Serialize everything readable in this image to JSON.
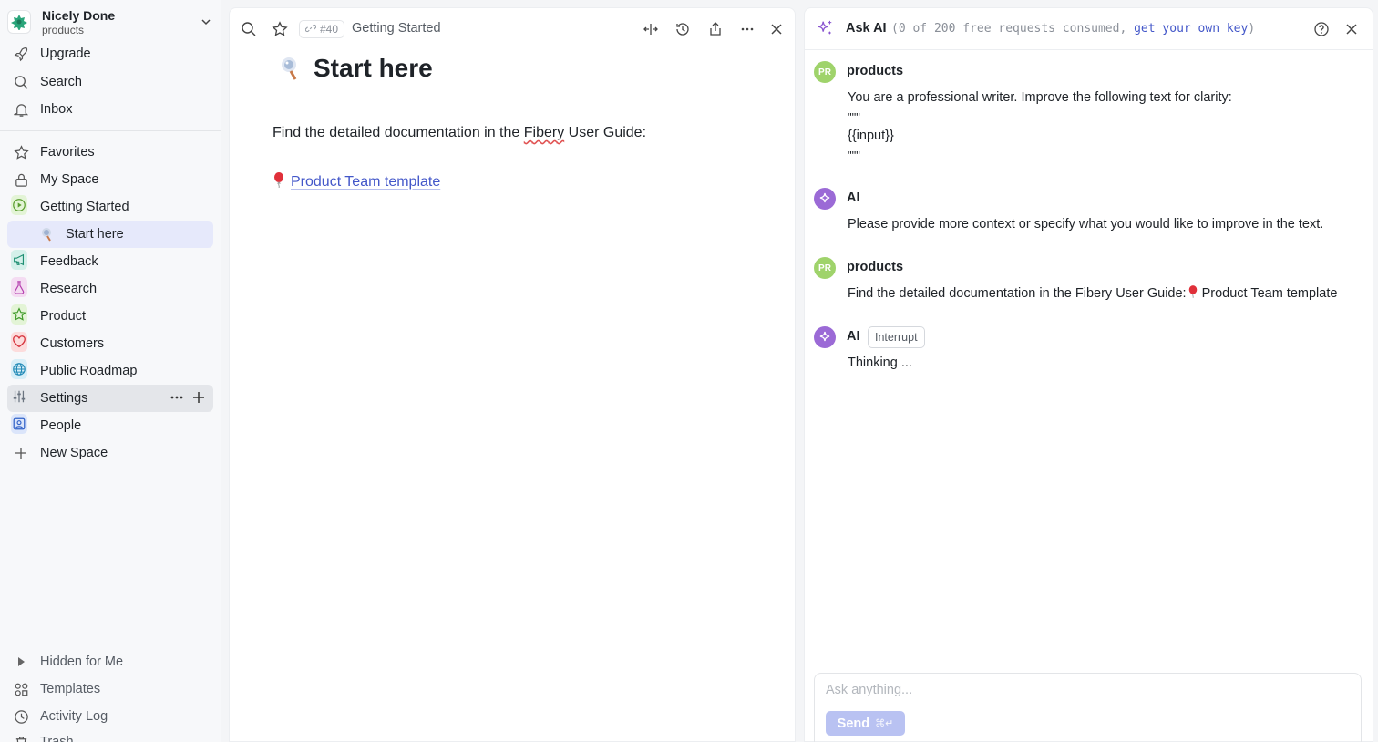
{
  "workspace": {
    "name": "Nicely Done",
    "subtitle": "products"
  },
  "sidebar": {
    "top": [
      {
        "label": "Upgrade",
        "icon": "rocket-icon"
      },
      {
        "label": "Search",
        "icon": "search-icon"
      },
      {
        "label": "Inbox",
        "icon": "bell-icon"
      }
    ],
    "spaces": [
      {
        "label": "Favorites",
        "icon": "star-icon"
      },
      {
        "label": "My Space",
        "icon": "lock-icon"
      },
      {
        "label": "Getting Started",
        "icon": "play-icon"
      },
      {
        "label": "Start here",
        "icon": "start-here-emoji-icon"
      },
      {
        "label": "Feedback",
        "icon": "megaphone-icon"
      },
      {
        "label": "Research",
        "icon": "flask-icon"
      },
      {
        "label": "Product",
        "icon": "star-icon"
      },
      {
        "label": "Customers",
        "icon": "heart-icon"
      },
      {
        "label": "Public Roadmap",
        "icon": "globe-icon"
      },
      {
        "label": "Settings",
        "icon": "sliders-icon"
      },
      {
        "label": "People",
        "icon": "person-card-icon"
      },
      {
        "label": "New Space",
        "icon": "plus-icon"
      }
    ],
    "bottom": [
      {
        "label": "Hidden for Me",
        "icon": "triangle-right-icon"
      },
      {
        "label": "Templates",
        "icon": "templates-icon"
      },
      {
        "label": "Activity Log",
        "icon": "clock-icon"
      },
      {
        "label": "Trash",
        "icon": "trash-icon"
      }
    ]
  },
  "doc": {
    "id_tag": "#40",
    "breadcrumb": "Getting Started",
    "title": "Start here",
    "para_before": "Find the detailed documentation in the ",
    "para_spell": "Fibery",
    "para_after": " User Guide:",
    "link_text": "Product Team template"
  },
  "ai": {
    "title": "Ask AI",
    "quota_prefix": "(0 of 200 free requests consumed, ",
    "quota_link": "get your own key",
    "quota_suffix": ")",
    "messages": [
      {
        "author": "products",
        "avatar": "PR",
        "lines": [
          "You are a professional writer. Improve the following text for clarity:",
          "\"\"\"",
          "{{input}}",
          "\"\"\""
        ]
      },
      {
        "author": "AI",
        "lines": [
          "Please provide more context or specify what you would like to improve in the text."
        ]
      },
      {
        "author": "products",
        "avatar": "PR",
        "lines": [
          "Find the detailed documentation in the Fibery User Guide:",
          "Product Team template"
        ]
      },
      {
        "author": "AI",
        "interrupt": "Interrupt",
        "lines": [
          "Thinking ..."
        ]
      }
    ],
    "input_placeholder": "Ask anything...",
    "send_label": "Send",
    "send_shortcut": "⌘↵"
  },
  "colors": {
    "accent": "#4357c9",
    "ai_purple": "#9b6ad6",
    "pr_green": "#9fd36b",
    "send_bg": "#b9c2f2"
  }
}
